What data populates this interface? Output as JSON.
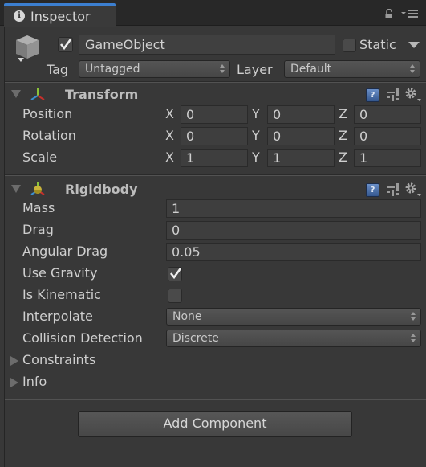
{
  "window": {
    "tab_label": "Inspector",
    "tab_icon": "info-icon",
    "lock_icon": "lock-icon",
    "menu_icon": "tab-menu-icon",
    "accent_color": "#3c7fd0"
  },
  "game_object": {
    "active": true,
    "name": "GameObject",
    "static_label": "Static",
    "static": false,
    "tag_label": "Tag",
    "tag_value": "Untagged",
    "layer_label": "Layer",
    "layer_value": "Default"
  },
  "transform": {
    "title": "Transform",
    "expanded": true,
    "rows": [
      {
        "label": "Position",
        "x": "0",
        "y": "0",
        "z": "0"
      },
      {
        "label": "Rotation",
        "x": "0",
        "y": "0",
        "z": "0"
      },
      {
        "label": "Scale",
        "x": "1",
        "y": "1",
        "z": "1"
      }
    ],
    "axes": [
      "X",
      "Y",
      "Z"
    ]
  },
  "rigidbody": {
    "title": "Rigidbody",
    "expanded": true,
    "mass_label": "Mass",
    "mass": "1",
    "drag_label": "Drag",
    "drag": "0",
    "angular_drag_label": "Angular Drag",
    "angular_drag": "0.05",
    "use_gravity_label": "Use Gravity",
    "use_gravity": true,
    "is_kinematic_label": "Is Kinematic",
    "is_kinematic": false,
    "interpolate_label": "Interpolate",
    "interpolate": "None",
    "collision_detection_label": "Collision Detection",
    "collision_detection": "Discrete",
    "constraints_label": "Constraints",
    "info_label": "Info"
  },
  "help_glyph": "?",
  "add_component_label": "Add Component"
}
